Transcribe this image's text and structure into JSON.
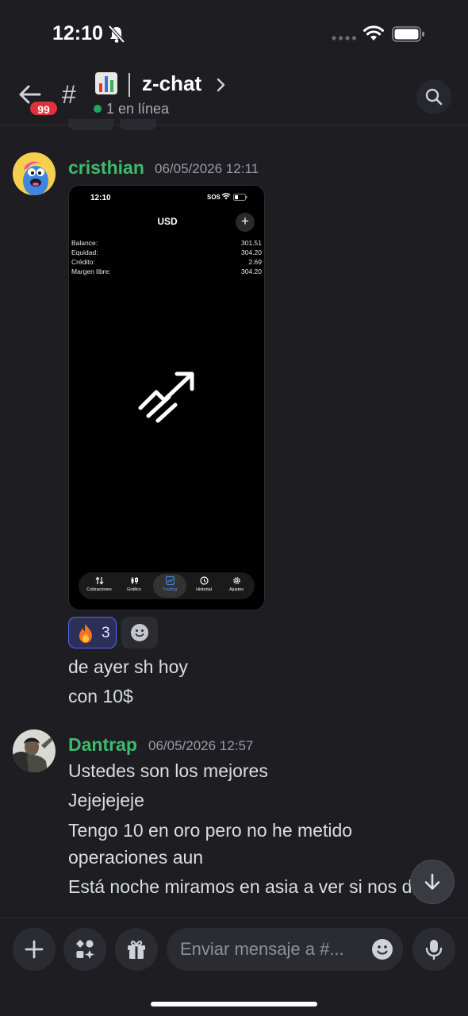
{
  "status_bar": {
    "time": "12:10"
  },
  "header": {
    "unread_count": "99",
    "channel_prefix": "#",
    "channel_name": "z-chat",
    "online_status": "1 en línea"
  },
  "messages": [
    {
      "username": "cristhian",
      "timestamp": "06/05/2026 12:11",
      "attachment": {
        "time": "12:10",
        "sos": "SOS",
        "title": "USD",
        "plus": "+",
        "rows": [
          {
            "label": "Balance:",
            "value": "301.51"
          },
          {
            "label": "Equidad:",
            "value": "304.20"
          },
          {
            "label": "Crédito:",
            "value": "2.69"
          },
          {
            "label": "Margen libre:",
            "value": "304.20"
          }
        ],
        "tabs": [
          {
            "label": "Cotizaciones",
            "icon": "arrows-icon"
          },
          {
            "label": "Gráfico",
            "icon": "candles-icon"
          },
          {
            "label": "Trading",
            "icon": "chart-icon",
            "active": true
          },
          {
            "label": "Historial",
            "icon": "clock-icon"
          },
          {
            "label": "Ajustes",
            "icon": "gear-icon"
          }
        ]
      },
      "reactions": [
        {
          "emoji": "fire-icon",
          "count": "3"
        }
      ],
      "lines": [
        "de ayer sh hoy",
        "con 10$"
      ]
    },
    {
      "username": "Dantrap",
      "timestamp": "06/05/2026 12:57",
      "lines": [
        "Ustedes son los mejores",
        "Jejejejeje",
        "Tengo 10 en oro pero no he metido",
        "operaciones aun",
        "Está noche miramos en asia a ver si nos d"
      ]
    }
  ],
  "composer": {
    "placeholder": "Enviar mensaje a #..."
  },
  "colors": {
    "background": "#1d1d22",
    "username": "#3dbb6c",
    "badge": "#e0323b",
    "reaction_active": "#5865f2",
    "online": "#23a55a"
  }
}
